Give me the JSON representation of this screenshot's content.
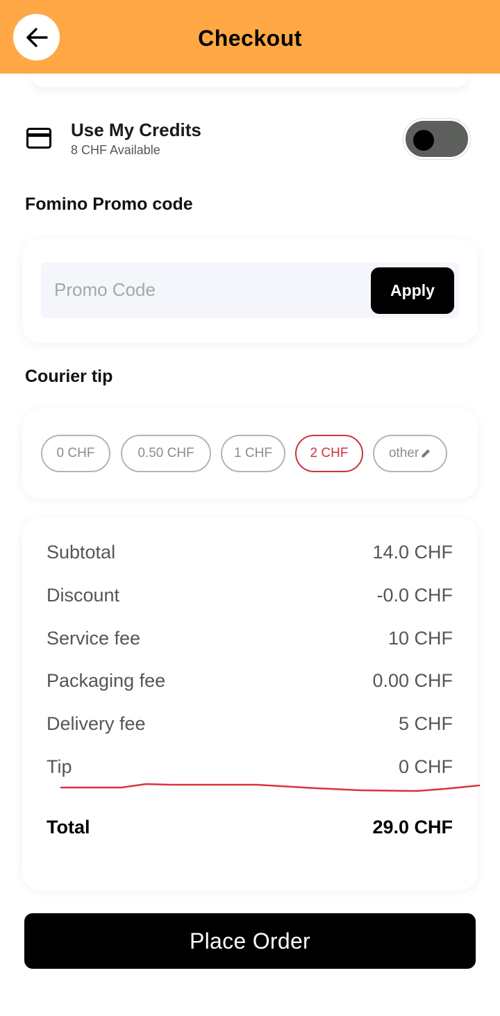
{
  "header": {
    "title": "Checkout",
    "back_icon": "arrow-left-icon",
    "background": "#ffa845"
  },
  "credits": {
    "icon": "credit-card-icon",
    "title": "Use My Credits",
    "available": "8 CHF Available",
    "toggle_on": false
  },
  "promo": {
    "section_title": "Fomino Promo code",
    "placeholder": "Promo Code",
    "value": "",
    "apply_label": "Apply"
  },
  "tip": {
    "section_title": "Courier tip",
    "options": [
      {
        "label": "0 CHF",
        "selected": false
      },
      {
        "label": "0.50 CHF",
        "selected": false
      },
      {
        "label": "1 CHF",
        "selected": false
      },
      {
        "label": "2 CHF",
        "selected": true
      },
      {
        "label": "other",
        "selected": false,
        "icon": "pencil-icon"
      }
    ],
    "selected_color": "#c9343e"
  },
  "summary": {
    "rows": [
      {
        "label": "Subtotal",
        "value": "14.0 CHF"
      },
      {
        "label": "Discount",
        "value": "-0.0 CHF"
      },
      {
        "label": "Service fee",
        "value": "10 CHF"
      },
      {
        "label": "Packaging fee",
        "value": "0.00 CHF"
      },
      {
        "label": "Delivery fee",
        "value": "5 CHF"
      },
      {
        "label": "Tip",
        "value": "0 CHF"
      }
    ],
    "total_label": "Total",
    "total_value": "29.0 CHF"
  },
  "place_order_label": "Place Order"
}
